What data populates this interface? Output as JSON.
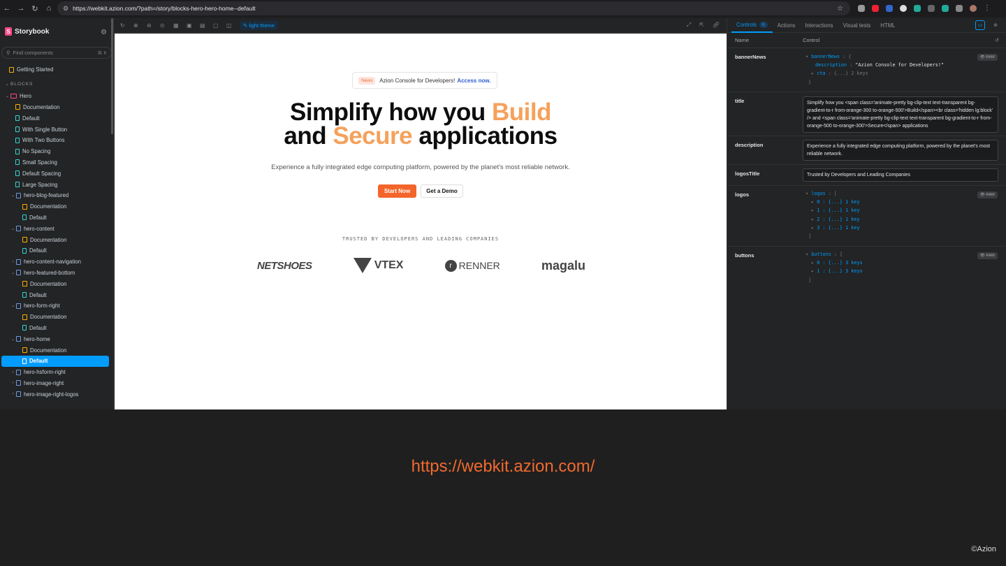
{
  "browser": {
    "url": "https://webkit.azion.com/?path=/story/blocks-hero-hero-home--default"
  },
  "sidebar": {
    "brand": "Storybook",
    "search_placeholder": "Find components",
    "search_shortcut": "⌘ K",
    "getting_started": "Getting Started",
    "section": "BLOCKS",
    "items": [
      {
        "label": "Hero",
        "type": "folder",
        "level": 0
      },
      {
        "label": "Documentation",
        "type": "doc",
        "level": 1
      },
      {
        "label": "Default",
        "type": "story",
        "level": 1
      },
      {
        "label": "With Single Button",
        "type": "story",
        "level": 1
      },
      {
        "label": "With Two Buttons",
        "type": "story",
        "level": 1
      },
      {
        "label": "No Spacing",
        "type": "story",
        "level": 1
      },
      {
        "label": "Small Spacing",
        "type": "story",
        "level": 1
      },
      {
        "label": "Default Spacing",
        "type": "story",
        "level": 1
      },
      {
        "label": "Large Spacing",
        "type": "story",
        "level": 1
      },
      {
        "label": "hero-blog-featured",
        "type": "component",
        "level": 1,
        "open": true
      },
      {
        "label": "Documentation",
        "type": "doc",
        "level": 2
      },
      {
        "label": "Default",
        "type": "story",
        "level": 2
      },
      {
        "label": "hero-content",
        "type": "component",
        "level": 1,
        "open": true
      },
      {
        "label": "Documentation",
        "type": "doc",
        "level": 2
      },
      {
        "label": "Default",
        "type": "story",
        "level": 2
      },
      {
        "label": "hero-content-navigation",
        "type": "component",
        "level": 1,
        "open": false
      },
      {
        "label": "hero-featured-bottom",
        "type": "component",
        "level": 1,
        "open": true
      },
      {
        "label": "Documentation",
        "type": "doc",
        "level": 2
      },
      {
        "label": "Default",
        "type": "story",
        "level": 2
      },
      {
        "label": "hero-form-right",
        "type": "component",
        "level": 1,
        "open": true
      },
      {
        "label": "Documentation",
        "type": "doc",
        "level": 2
      },
      {
        "label": "Default",
        "type": "story",
        "level": 2
      },
      {
        "label": "hero-home",
        "type": "component",
        "level": 1,
        "open": true
      },
      {
        "label": "Documentation",
        "type": "doc",
        "level": 2
      },
      {
        "label": "Default",
        "type": "story",
        "level": 2,
        "selected": true
      },
      {
        "label": "hero-hsform-right",
        "type": "component",
        "level": 1,
        "open": false
      },
      {
        "label": "hero-image-right",
        "type": "component",
        "level": 1,
        "open": false
      },
      {
        "label": "hero-image-right-logos",
        "type": "component",
        "level": 1,
        "open": false
      }
    ]
  },
  "toolbar": {
    "theme_label": "light theme"
  },
  "preview": {
    "news_tag": "News",
    "news_text": "Azion Console for Developers!",
    "news_cta": "Access now.",
    "title_part1": "Simplify how you ",
    "title_build": "Build",
    "title_part2": "and ",
    "title_secure": "Secure",
    "title_part3": " applications",
    "description": "Experience a fully integrated edge computing platform, powered by the planet's most reliable network.",
    "start_button": "Start Now",
    "demo_button": "Get a Demo",
    "logos_title": "TRUSTED BY DEVELOPERS AND LEADING COMPANIES",
    "logos": [
      "NETSHOES",
      "VTEX",
      "RENNER",
      "magalu"
    ]
  },
  "panel": {
    "tabs": [
      "Controls",
      "Actions",
      "Interactions",
      "Visual tests",
      "HTML"
    ],
    "controls_count": "6",
    "col_name": "Name",
    "col_control": "Control",
    "raw_label": "RAW",
    "bannerNews": {
      "name": "bannerNews",
      "key": "bannerNews",
      "desc_key": "description",
      "desc_value": "\"Azion Console for Developers!\"",
      "cta_key": "cta",
      "cta_value": "{...} 2 keys"
    },
    "title": {
      "name": "title",
      "value": "Simplify how you <span class='animate-pretty bg-clip-text text-transparent bg-gradient-to-r from-orange-300 to-orange-500'>Build</span><br class='hidden lg:block' /> and <span class='animate-pretty bg-clip-text text-transparent bg-gradient-to-r from-orange-500 to-orange-300'>Secure</span> applications"
    },
    "description": {
      "name": "description",
      "value": "Experience a fully integrated edge computing platform, powered by the planet's most reliable network."
    },
    "logosTitle": {
      "name": "logosTitle",
      "value": "Trusted by Developers and Leading Companies"
    },
    "logos": {
      "name": "logos",
      "key": "logos",
      "entries": [
        "0 : {...} 1 key",
        "1 : {...} 1 key",
        "2 : {...} 1 key",
        "3 : {...} 1 key"
      ]
    },
    "buttons": {
      "name": "buttons",
      "key": "buttons",
      "entries": [
        "0 : {...} 3 keys",
        "1 : {...} 3 keys"
      ]
    }
  },
  "footer": {
    "url": "https://webkit.azion.com/",
    "copyright": "©Azion"
  },
  "colors": {
    "accent": "#029cfd",
    "brand_orange": "#f3652b",
    "storybook_pink": "#ff4785"
  }
}
